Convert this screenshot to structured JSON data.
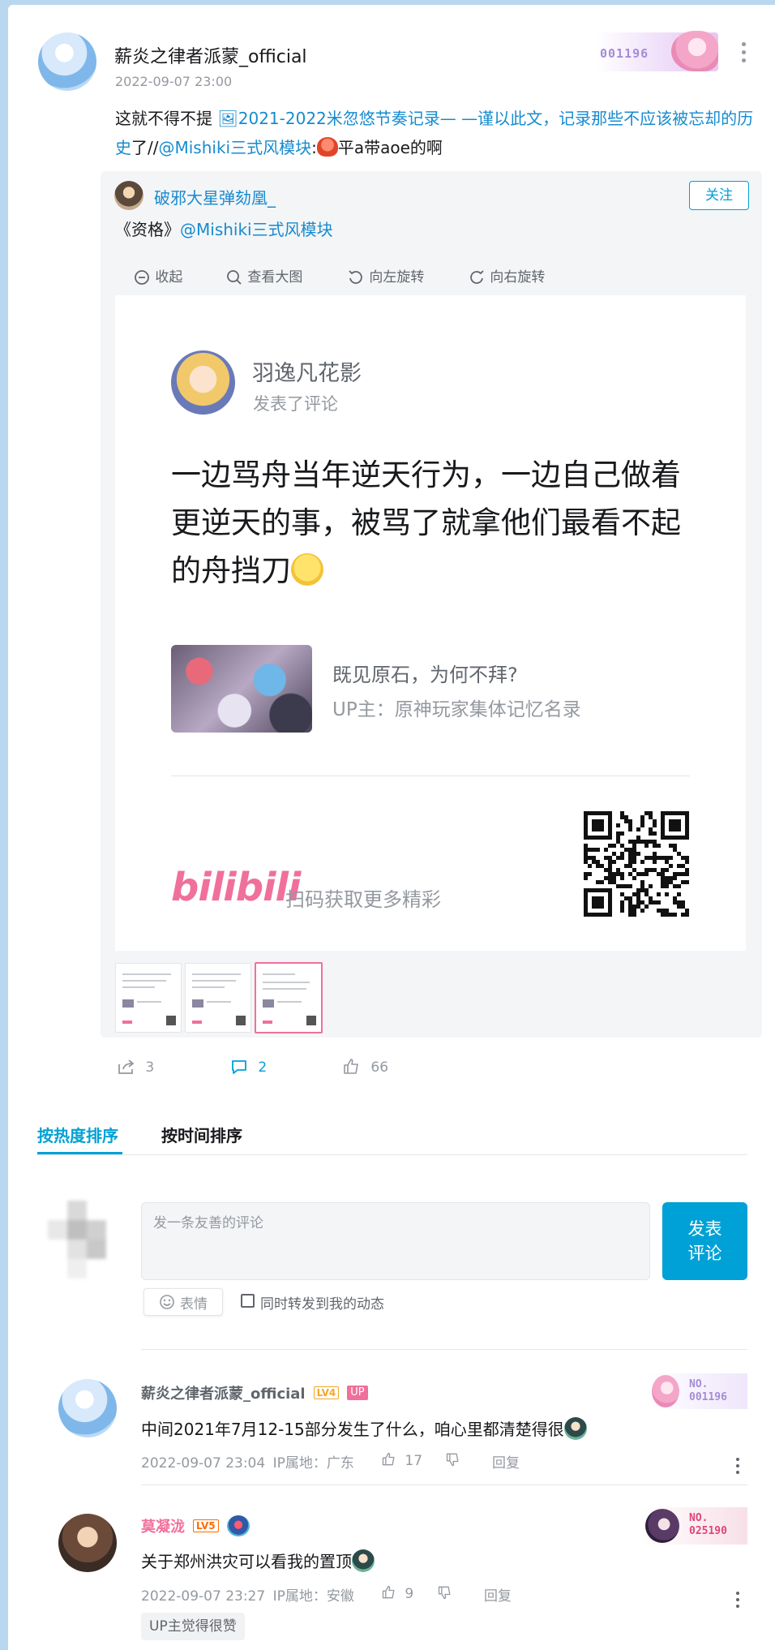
{
  "post": {
    "author": "薪炎之律者派蒙_official",
    "time": "2022-09-07 23:00",
    "fan_badge_number": "001196",
    "content": {
      "part1": "这就不得不提 ",
      "link_video": "2021-2022米忽悠节奏记录— —谨以此文，记录那些不应该被忘却的历史",
      "part2": "了//",
      "mention": "@Mishiki三式风模块",
      "part3": ":",
      "emoji_name": "red-octopus-emoji",
      "part4": "平a带aoe的啊"
    }
  },
  "repost": {
    "author": "破邪大星弹劾凰_",
    "follow_label": "关注",
    "text_prefix": "《资格》",
    "text_mention": "@Mishiki三式风模块",
    "toolbar": {
      "collapse": "收起",
      "view_large": "查看大图",
      "rotate_left": "向左旋转",
      "rotate_right": "向右旋转"
    },
    "image_card": {
      "user": "羽逸凡花影",
      "action": "发表了评论",
      "text": "一边骂舟当年逆天行为，一边自己做着更逆天的事，被骂了就拿他们最看不起的舟挡刀",
      "video_title": "既见原石，为何不拜?",
      "video_up": "UP主：原神玩家集体记忆名录",
      "logo": "bilibili",
      "scan_text": "扫码获取更多精彩"
    }
  },
  "actions": {
    "forward_count": "3",
    "comment_count": "2",
    "like_count": "66"
  },
  "sort_tabs": {
    "hot": "按热度排序",
    "time": "按时间排序"
  },
  "comment_box": {
    "placeholder": "发一条友善的评论",
    "submit": "发表\n评论",
    "submit_line1": "发表",
    "submit_line2": "评论",
    "emoji": "表情",
    "sync_label": "同时转发到我的动态"
  },
  "comments": [
    {
      "name": "薪炎之律者派蒙_official",
      "level": "LV4",
      "up_tag": "UP",
      "badge_no": "NO.",
      "badge_number": "001196",
      "text": "中间2021年7月12-15部分发生了什么，咱心里都清楚得很",
      "time": "2022-09-07 23:04",
      "ip": "IP属地：广东",
      "likes": "17",
      "reply": "回复"
    },
    {
      "name": "莫凝泷",
      "level": "LV5",
      "badge_no": "NO.",
      "badge_number": "025190",
      "text": "关于郑州洪灾可以看我的置顶",
      "time": "2022-09-07 23:27",
      "ip": "IP属地：安徽",
      "likes": "9",
      "reply": "回复",
      "tag": "UP主觉得很赞"
    }
  ],
  "colors": {
    "accent": "#00a1d6",
    "link": "#178bcf",
    "pink": "#f0709b",
    "background": "#b9d7ef"
  }
}
